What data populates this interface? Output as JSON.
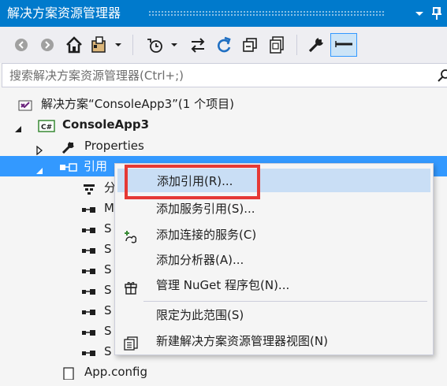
{
  "window": {
    "title": "解决方案资源管理器",
    "accent": "#007acc"
  },
  "toolbar": {
    "buttons": [
      "back-icon",
      "forward-icon",
      "home-icon",
      "switch-views-icon",
      "pending-changes-icon",
      "sync-icon",
      "refresh-icon",
      "collapse-all-icon",
      "show-all-files-icon",
      "properties-icon",
      "preview-icon"
    ]
  },
  "search": {
    "placeholder": "搜索解决方案资源管理器(Ctrl+;)",
    "value": ""
  },
  "tree": {
    "solution": "解决方案“ConsoleApp3”(1 个项目)",
    "project": "ConsoleApp3",
    "project_badge": "C#",
    "properties": "Properties",
    "references": "引用",
    "ref_children": [
      "分",
      "M",
      "S",
      "S",
      "S",
      "S",
      "S",
      "S",
      "S"
    ],
    "app_config": "App.config"
  },
  "context_menu": {
    "items": [
      {
        "label": "添加引用(R)...",
        "icon": ""
      },
      {
        "label": "添加服务引用(S)...",
        "icon": ""
      },
      {
        "label": "添加连接的服务(C)",
        "icon": "connected-service-icon"
      },
      {
        "label": "添加分析器(A)...",
        "icon": ""
      },
      {
        "label": "管理 NuGet 程序包(N)...",
        "icon": "nuget-icon"
      },
      {
        "label": "限定为此范围(S)",
        "icon": ""
      },
      {
        "label": "新建解决方案资源管理器视图(N)",
        "icon": "new-view-icon"
      }
    ],
    "highlighted_item": "添加引用(R)...",
    "highlight_color": "#e53935"
  }
}
